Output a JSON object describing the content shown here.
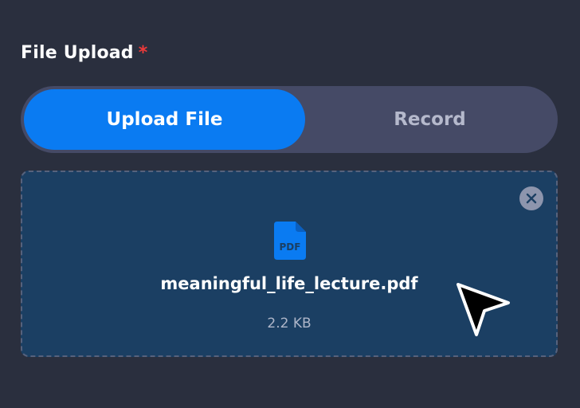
{
  "field": {
    "label": "File Upload",
    "required_mark": "*"
  },
  "toggle": {
    "options": [
      {
        "label": "Upload File",
        "selected": true
      },
      {
        "label": "Record",
        "selected": false
      }
    ]
  },
  "uploaded_file": {
    "icon": "pdf-file-icon",
    "icon_text": "PDF",
    "name": "meaningful_life_lecture.pdf",
    "size": "2.2 KB"
  },
  "colors": {
    "background": "#2a2f3e",
    "accent": "#0a7bf2",
    "dropzone": "#1b3f63",
    "required": "#ee3a3a"
  }
}
